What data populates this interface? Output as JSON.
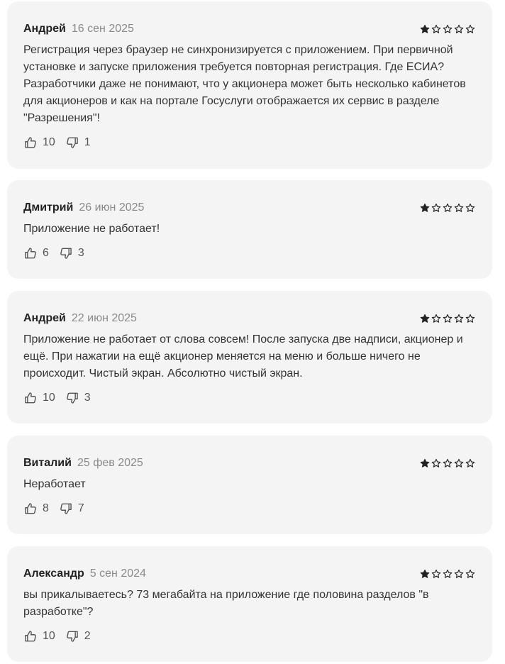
{
  "reviews": [
    {
      "author": "Андрей",
      "date": "16 сен 2025",
      "rating": 1,
      "text": "Регистрация через браузер не синхронизируется с приложением. При первичной установке и запуске приложения требуется повторная регистрация. Где ЕСИА? Разработчики даже не понимают, что у акционера может быть несколько кабинетов для акционеров и как на портале Госуслуги отображается их сервис в разделе \"Разрешения\"!",
      "likes": "10",
      "dislikes": "1"
    },
    {
      "author": "Дмитрий",
      "date": "26 июн 2025",
      "rating": 1,
      "text": "Приложение не работает!",
      "likes": "6",
      "dislikes": "3"
    },
    {
      "author": "Андрей",
      "date": "22 июн 2025",
      "rating": 1,
      "text": "Приложение не работает от слова совсем! После запуска две надписи, акционер и ещё. При нажатии на ещё акционер меняется на меню и больше ничего не происходит. Чистый экран. Абсолютно чистый экран.",
      "likes": "10",
      "dislikes": "3"
    },
    {
      "author": "Виталий",
      "date": "25 фев 2025",
      "rating": 1,
      "text": "Неработает",
      "likes": "8",
      "dislikes": "7"
    },
    {
      "author": "Александр",
      "date": "5 сен 2024",
      "rating": 1,
      "text": "вы прикалываетесь? 73 мегабайта на приложение где половина разделов \"в разработке\"?",
      "likes": "10",
      "dislikes": "2"
    }
  ],
  "rating_max": 5,
  "colors": {
    "card_bg": "#f4f4f4",
    "star": "#222222",
    "muted": "#8a8a8a"
  },
  "icons": {
    "like": "thumb-up-icon",
    "dislike": "thumb-down-icon",
    "star": "star-icon"
  }
}
